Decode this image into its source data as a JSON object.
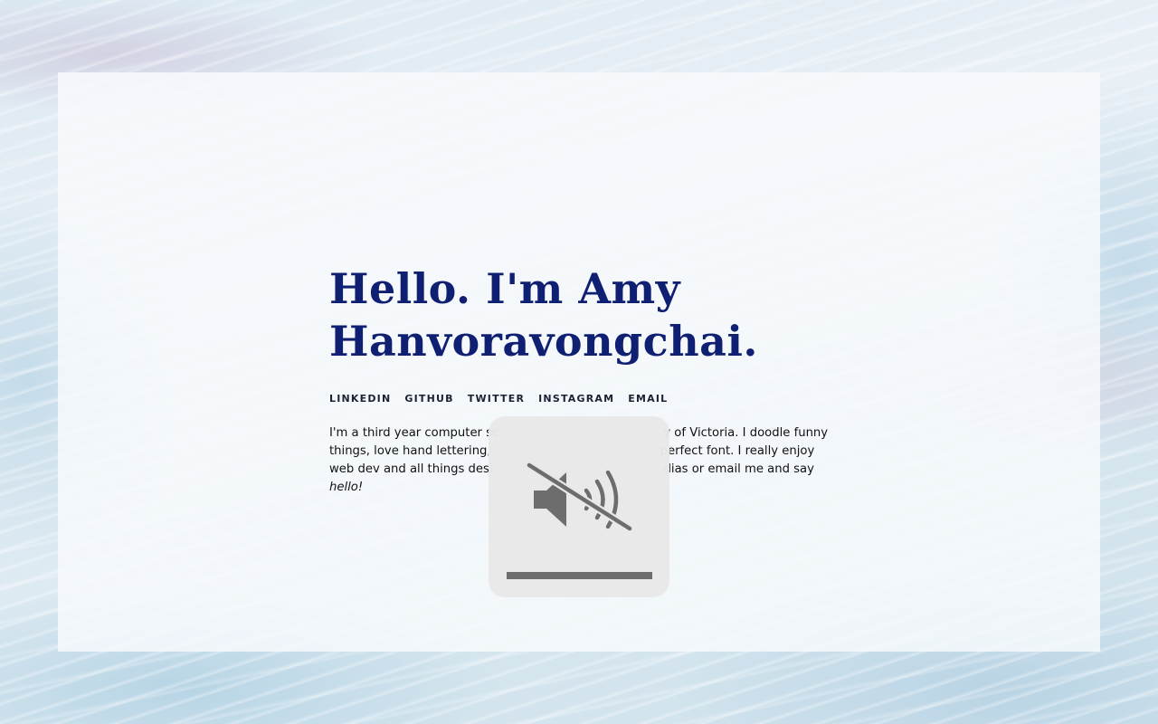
{
  "hero": {
    "title_line1": "Hello. I'm Amy",
    "title_line2": "Hanvoravongchai."
  },
  "nav": {
    "linkedin": "LINKEDIN",
    "github": "GITHUB",
    "twitter": "TWITTER",
    "instagram": "INSTAGRAM",
    "email": "EMAIL"
  },
  "bio": {
    "line1": "I'm a third year computer sc",
    "line1_end": "y of Victoria. I doodle funny",
    "line2": "things, love hand lettering,",
    "line2_end": "perfect font. I really enjoy",
    "line3": "web dev and all things desi",
    "line3_end": "dias or email me and say",
    "line4": "hello!"
  },
  "volume_overlay": {
    "icon": "speaker-muted-icon",
    "muted": true,
    "level": 1.0
  },
  "colors": {
    "title": "#0f1f72",
    "nav": "#1c2233",
    "hud_bg": "#e8e8e8",
    "hud_icon": "#6d6d6d"
  }
}
